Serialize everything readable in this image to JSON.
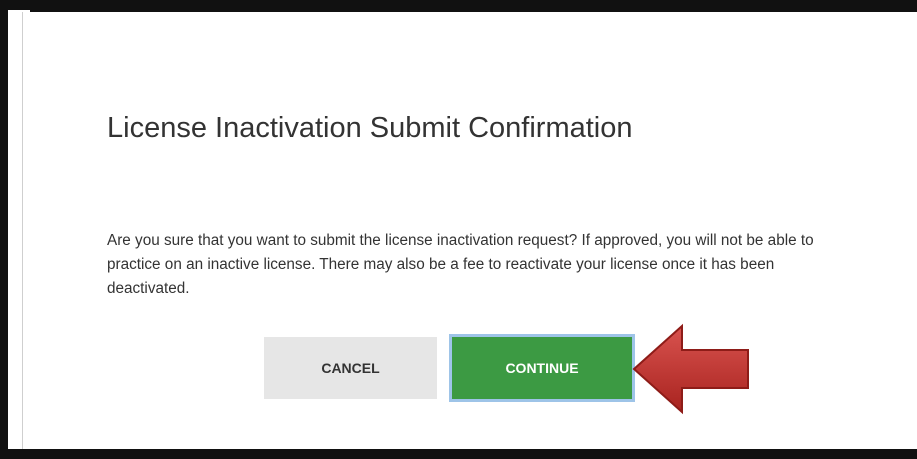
{
  "dialog": {
    "title": "License Inactivation Submit Confirmation",
    "message": "Are you sure that you want to submit the license inactivation request? If approved, you will not be able to practice on an inactive license. There may also be a fee to reactivate your license once it has been deactivated.",
    "cancel_label": "CANCEL",
    "continue_label": "CONTINUE"
  },
  "annotation": {
    "arrow_icon": "left-arrow-icon",
    "arrow_color": "#c0392b"
  },
  "colors": {
    "continue_bg": "#3c9a43",
    "cancel_bg": "#e6e6e6",
    "focus_outline": "#9ec4e8"
  }
}
